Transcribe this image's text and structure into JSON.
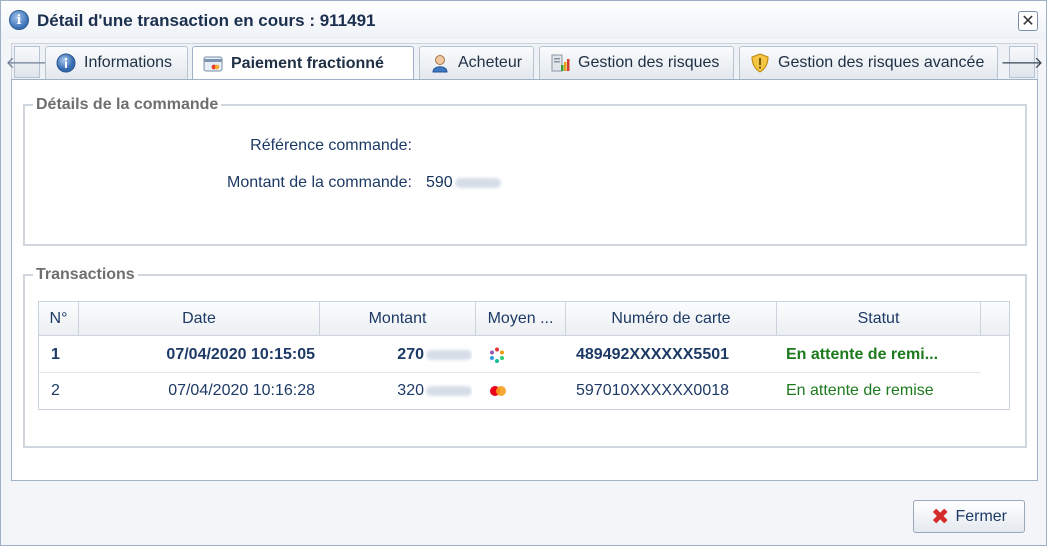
{
  "window": {
    "title": "Détail d'une transaction en cours : 911491",
    "info_icon_glyph": "i",
    "close_glyph": "✕"
  },
  "tabs": {
    "prev_glyph": "🡐",
    "next_glyph": "🡒",
    "items": [
      {
        "label": "Informations",
        "icon": "info-icon"
      },
      {
        "label": "Paiement fractionné",
        "icon": "installment-payment-icon",
        "active": true
      },
      {
        "label": "Acheteur",
        "icon": "buyer-icon"
      },
      {
        "label": "Gestion des risques",
        "icon": "risk-management-icon"
      },
      {
        "label": "Gestion des risques avancée",
        "icon": "advanced-risk-shield-icon"
      }
    ]
  },
  "order": {
    "legend": "Détails de la commande",
    "reference_label": "Référence commande:",
    "reference_value": "",
    "amount_label": "Montant de la commande:",
    "amount_value": "590"
  },
  "transactions": {
    "legend": "Transactions",
    "columns": [
      "N°",
      "Date",
      "Montant",
      "Moyen ...",
      "Numéro de carte",
      "Statut"
    ],
    "rows": [
      {
        "no": "1",
        "date": "07/04/2020 10:15:05",
        "amount": "270",
        "card_icon": "multicolor-card-brand-icon",
        "card_number": "489492XXXXXX5501",
        "status": "En attente de remi..."
      },
      {
        "no": "2",
        "date": "07/04/2020 10:16:28",
        "amount": "320",
        "card_icon": "mastercard-icon",
        "card_number": "597010XXXXXX0018",
        "status": "En attente de remise"
      }
    ]
  },
  "footer": {
    "close_label": "Fermer",
    "close_glyph": "✖"
  },
  "colors": {
    "status_green": "#1e7a1e",
    "label_blue": "#1d3a66"
  }
}
